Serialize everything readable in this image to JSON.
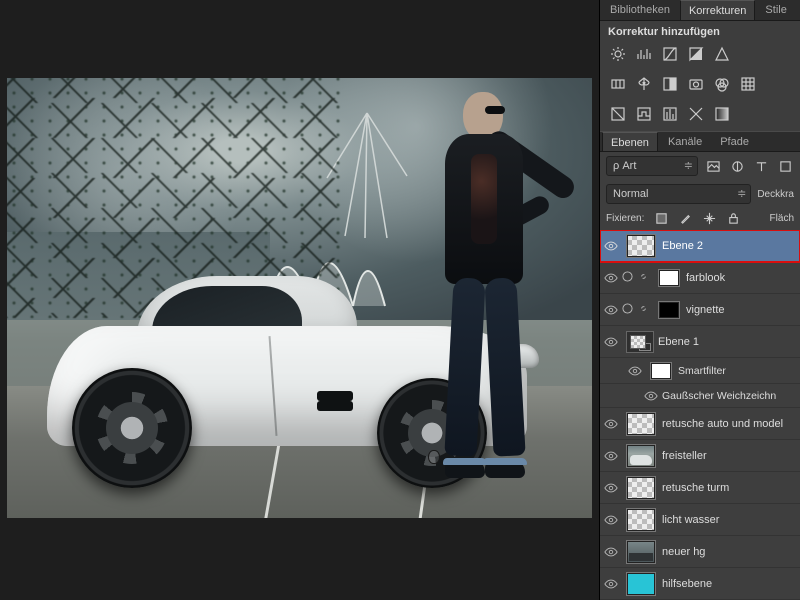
{
  "top_tabs": {
    "a": "Bibliotheken",
    "b": "Korrekturen",
    "c": "Stile"
  },
  "adj_header": "Korrektur hinzufügen",
  "layers_tabs": {
    "a": "Ebenen",
    "b": "Kanäle",
    "c": "Pfade"
  },
  "filter_select": "ρ Art",
  "blend_mode": "Normal",
  "opacity_label": "Deckkra",
  "lock_label": "Fixieren:",
  "fill_label": "Fläch",
  "layers": {
    "l0": "Ebene 2",
    "l1": "farblook",
    "l2": "vignette",
    "l3": "Ebene 1",
    "l3a": "Smartfilter",
    "l3b": "Gaußscher Weichzeichn",
    "l4": "retusche auto und model",
    "l5": "freisteller",
    "l6": "retusche turm",
    "l7": "licht wasser",
    "l8": "neuer hg",
    "l9": "hilfsebene"
  }
}
